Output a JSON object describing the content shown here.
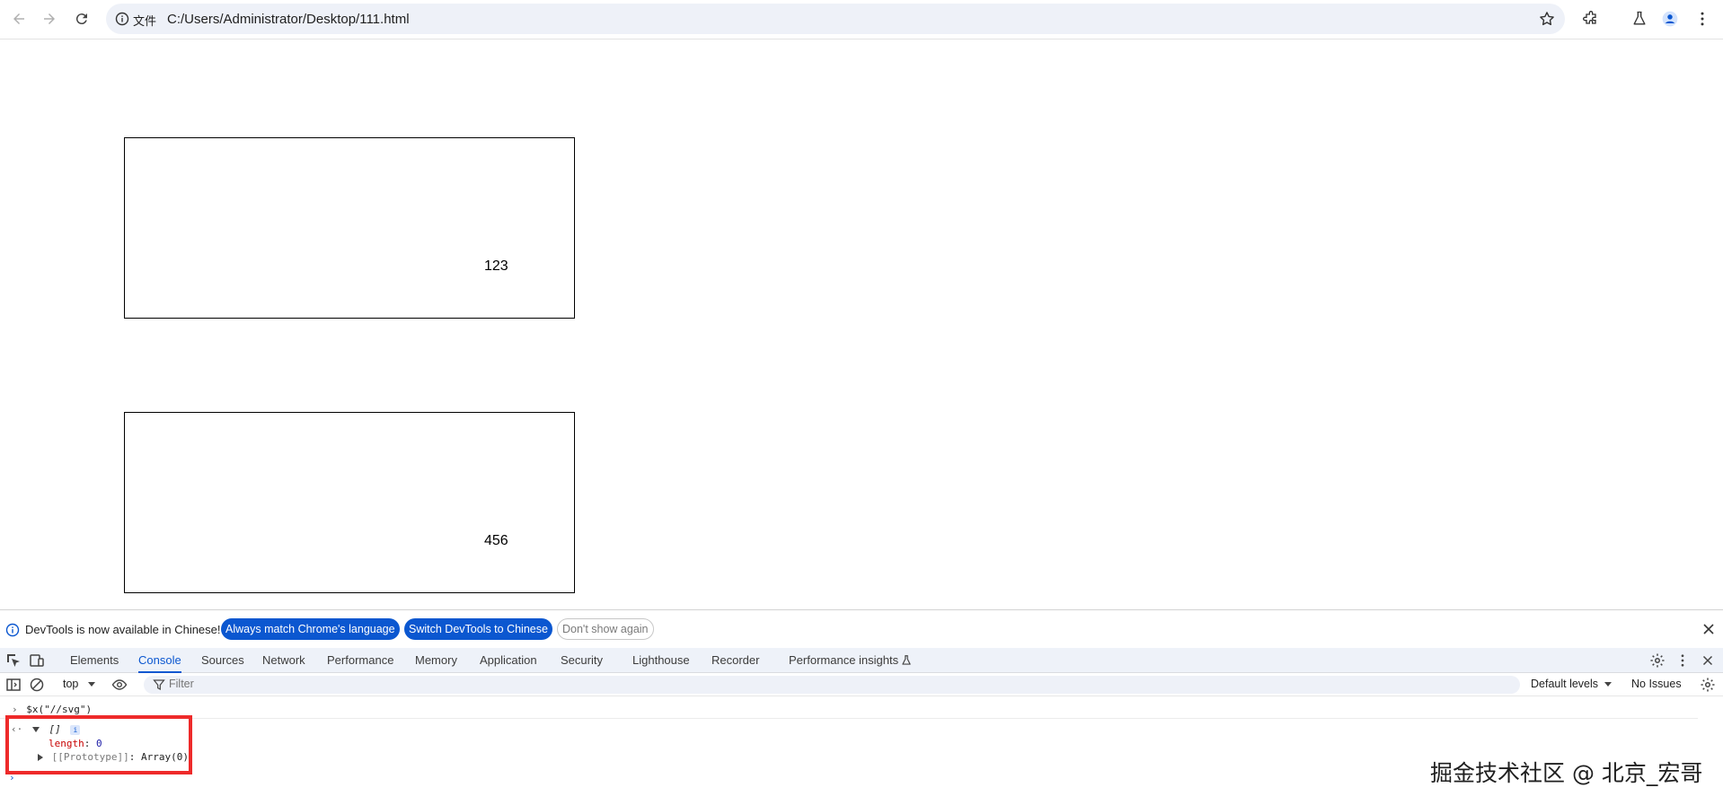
{
  "browser": {
    "scheme_label": "文件",
    "url": "C:/Users/Administrator/Desktop/111.html"
  },
  "page": {
    "boxes": [
      {
        "text": "123"
      },
      {
        "text": "456"
      }
    ]
  },
  "devtools": {
    "infobar": {
      "message": "DevTools is now available in Chinese!",
      "match_button": "Always match Chrome's language",
      "switch_button": "Switch DevTools to Chinese",
      "dismiss_button": "Don't show again"
    },
    "tabs": [
      {
        "label": "Elements"
      },
      {
        "label": "Console"
      },
      {
        "label": "Sources"
      },
      {
        "label": "Network"
      },
      {
        "label": "Performance"
      },
      {
        "label": "Memory"
      },
      {
        "label": "Application"
      },
      {
        "label": "Security"
      },
      {
        "label": "Lighthouse"
      },
      {
        "label": "Recorder"
      },
      {
        "label": "Performance insights"
      }
    ],
    "active_tab": "Console",
    "toolbar": {
      "context": "top",
      "filter_placeholder": "Filter",
      "levels": "Default levels",
      "issues": "No Issues"
    },
    "console": {
      "command": "$x(\"//svg\")",
      "result_summary": "[]",
      "length_key": "length",
      "length_value": "0",
      "proto_key": "[[Prototype]]",
      "proto_value": "Array(0)"
    }
  },
  "watermark": "掘金技术社区 @ 北京_宏哥",
  "colors": {
    "accent": "#0b57d0",
    "highlight": "#ee2a2a"
  }
}
